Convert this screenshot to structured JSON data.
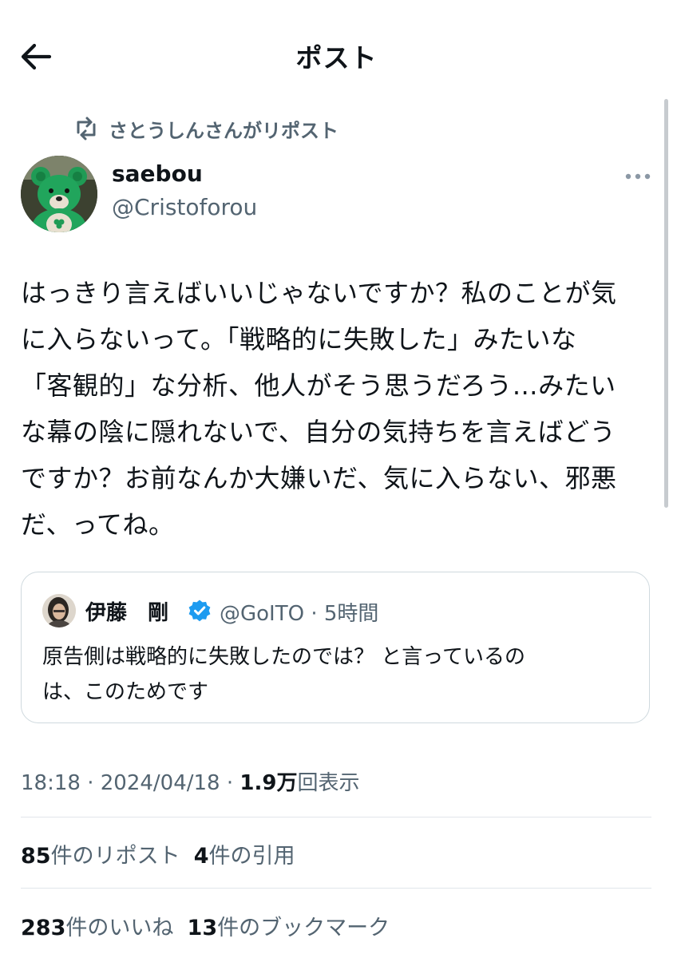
{
  "header": {
    "title": "ポスト"
  },
  "repost": {
    "text": "さとうしんさんがリポスト"
  },
  "author": {
    "name": "saebou",
    "handle": "@Cristoforou"
  },
  "post": {
    "text": "はっきり言えばいいじゃないですか？私のことが気\nに入らないって。「戦略的に失敗した」みたいな\n「客観的」な分析、他人がそう思うだろう…みたい\nな幕の陰に隠れないで、自分の気持ちを言えばどう\nですか？お前なんか大嫌いだ、気に入らない、邪悪\nだ、ってね。"
  },
  "quote": {
    "name": "伊藤　剛",
    "handle": "@GoITO",
    "separator": "·",
    "time": "5時間",
    "text": "原告側は戦略的に失敗したのでは？ と言っているの\nは、このためです"
  },
  "meta": {
    "time": "18:18",
    "separator": "·",
    "date": "2024/04/18",
    "views_count": "1.9万",
    "views_label": "回表示"
  },
  "stats": {
    "reposts_count": "85",
    "reposts_label": "件のリポスト",
    "quotes_count": "4",
    "quotes_label": "件の引用",
    "likes_count": "283",
    "likes_label": "件のいいね",
    "bookmarks_count": "13",
    "bookmarks_label": "件のブックマーク"
  },
  "colors": {
    "text": "#0f1419",
    "secondary": "#536471",
    "verified": "#1d9bf0",
    "border": "#cfd9de"
  },
  "icons": {
    "back": "arrow-left-icon",
    "repost": "repost-icon",
    "more": "more-horizontal-icon",
    "verified": "verified-badge-icon"
  }
}
